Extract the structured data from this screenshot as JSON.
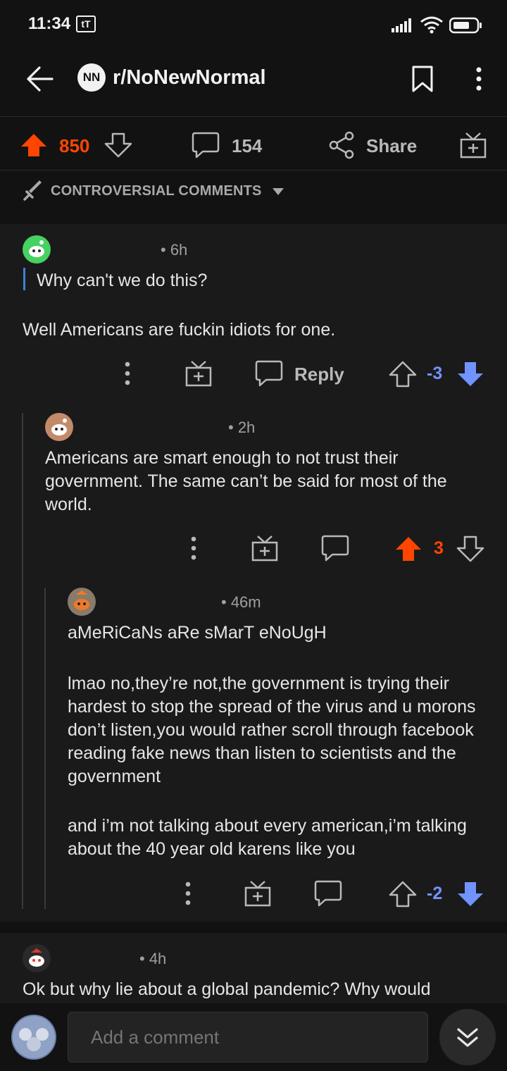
{
  "status_bar": {
    "time": "11:34",
    "badge": "tT"
  },
  "header": {
    "subreddit_icon_text": "NN",
    "subreddit": "r/NoNewNormal"
  },
  "post_actions": {
    "votes": "850",
    "comments": "154",
    "share_label": "Share"
  },
  "sort": {
    "label": "CONTROVERSIAL COMMENTS"
  },
  "comments": [
    {
      "age": "• 6h",
      "quote": "Why can't we do this?",
      "text": "Well Americans are fuckin idiots for one.",
      "reply_label": "Reply",
      "score": "-3",
      "vote_state": "down"
    },
    {
      "age": "• 2h",
      "text": "Americans are smart enough to not trust their government. The same can’t be said for most of the world.",
      "score": "3",
      "vote_state": "up"
    },
    {
      "age": "• 46m",
      "paragraphs": [
        "aMeRiCaNs aRe sMarT eNoUgH",
        "lmao no,they’re not,the government is trying their hardest to stop the spread of the virus and u morons don’t listen,you would rather scroll through facebook reading fake news than listen to scientists and the government",
        "and i’m not talking about every american,i’m talking about the 40 year old karens like you"
      ],
      "score": "-2",
      "vote_state": "down"
    },
    {
      "age": "• 4h",
      "text": "Ok but why lie about a global pandemic? Why would"
    }
  ],
  "composer": {
    "placeholder": "Add a comment"
  },
  "colors": {
    "upvote": "#ff4500",
    "downvote": "#7193ff",
    "quote_bar": "#3f7fd5",
    "background": "#1a1a1b"
  }
}
